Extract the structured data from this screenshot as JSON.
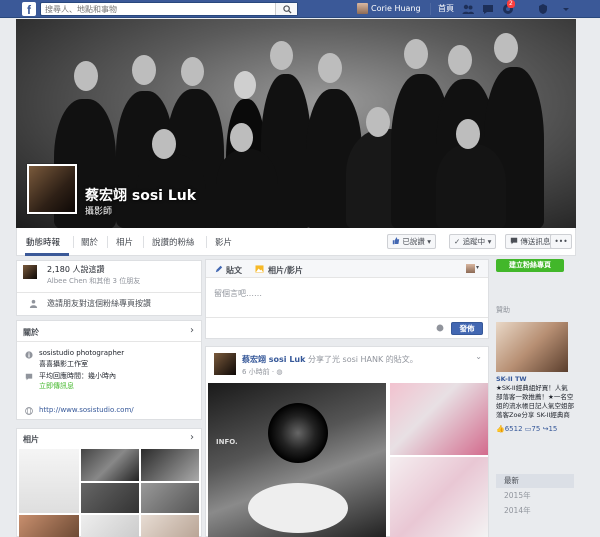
{
  "topbar": {
    "search_placeholder": "搜尋人、地點和事物",
    "user_name": "Corie Huang",
    "home_label": "首頁",
    "notification_count": "2"
  },
  "cover": {
    "page_name": "蔡宏翊 sosi Luk",
    "category": "攝影師"
  },
  "tabs": [
    {
      "label": "動態時報"
    },
    {
      "label": "關於"
    },
    {
      "label": "相片"
    },
    {
      "label": "說讚的粉絲"
    },
    {
      "label": "影片"
    }
  ],
  "actions": {
    "liked_label": "已說讚",
    "following_label": "追蹤中",
    "message_label": "傳送訊息",
    "more_label": "•••"
  },
  "likes_card": {
    "count_text": "2,180 人說這讚",
    "friends_text": "Albee Chen 和其他 3 位朋友",
    "invite_text": "邀請朋友對這個粉絲專頁按讚"
  },
  "about_card": {
    "title": "關於",
    "bio_line1": "sosistudio photographer",
    "bio_line2": "喜喜攝影工作室",
    "response_text": "平均回應時間：幾小時內",
    "message_link": "立即傳訊息",
    "website": "http://www.sosistudio.com/"
  },
  "photos_card": {
    "title": "相片"
  },
  "composer": {
    "tab_status": "貼文",
    "tab_photo": "相片/影片",
    "placeholder": "留個言吧……",
    "post_button": "發佈"
  },
  "post": {
    "author": "蔡宏翊 sosi Luk",
    "action": "分享了光 sosi HANK 的貼文。",
    "time": "6 小時前 · "
  },
  "right_col": {
    "create_ad_button": "建立粉絲專頁",
    "sponsored_label": "贊助",
    "ad_name": "SK-II TW",
    "ad_text": "★SK-II經典組好買！人氣部落客一致推薦！★一名空姐的流水帳日記人氣空姐部落客Zoe分享 SK-II經典商品經年乘載點採購攻略，特別推薦入門審膚保養的經典好攝擇—SK-II亮膚...",
    "ad_likes": "6512",
    "ad_comments": "75",
    "ad_shares": "15",
    "years": [
      "最新",
      "2015年",
      "2014年"
    ]
  },
  "colors": {
    "fb_blue": "#3b5998",
    "link_blue": "#365899",
    "green": "#42b72a",
    "bg": "#e9ebee"
  }
}
